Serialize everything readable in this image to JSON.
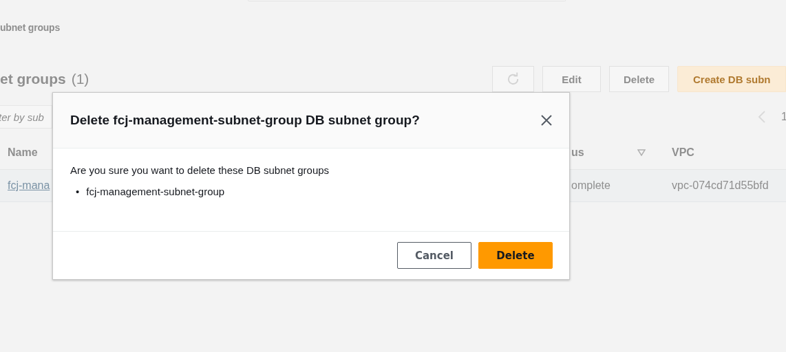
{
  "page": {
    "breadcrumb": "ubnet groups",
    "heading": "et groups",
    "count": "(1)",
    "toolbar": [
      {
        "kind": "refresh"
      },
      {
        "kind": "plain",
        "label": "Edit"
      },
      {
        "kind": "plain",
        "label": "Delete"
      },
      {
        "kind": "primary",
        "label": "Create DB subn"
      }
    ],
    "filter": {
      "placeholder": "ter by sub"
    },
    "pagination": {
      "page": "1"
    },
    "table": {
      "columns": [
        {
          "label": "Name",
          "sortable": false
        },
        {
          "label": "us",
          "sortable": true
        },
        {
          "label": "VPC",
          "sortable": false
        }
      ],
      "rows": [
        {
          "cells": [
            "fcj-mana",
            "omplete",
            "vpc-074cd71d55bfd"
          ]
        }
      ]
    }
  },
  "dialog": {
    "title": "Delete fcj-management-subnet-group DB subnet group?",
    "message": "Are you sure you want to delete these DB subnet groups",
    "items": [
      {
        "marker": "•",
        "text": "fcj-management-subnet-group"
      }
    ],
    "buttons": [
      {
        "kind": "secondary",
        "label": "Cancel"
      },
      {
        "kind": "primary",
        "label": "Delete"
      }
    ]
  }
}
